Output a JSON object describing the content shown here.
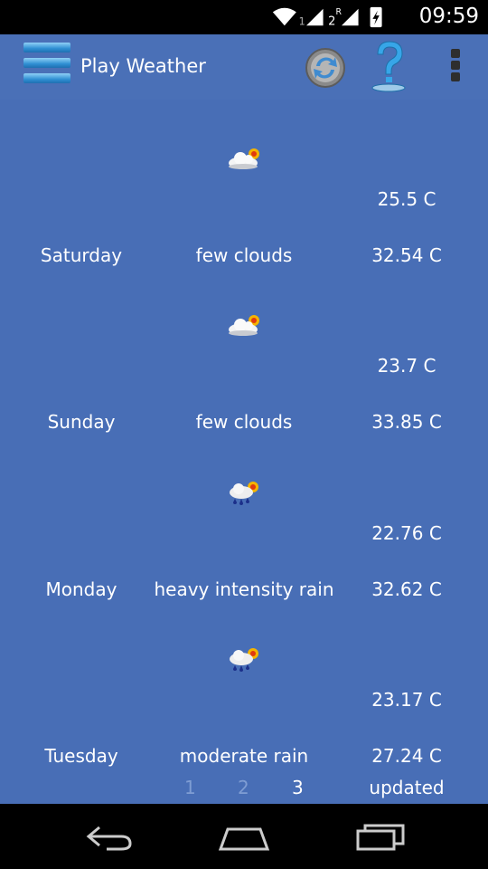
{
  "status_bar": {
    "time": "09:59",
    "sim1": "1",
    "sim2": "2",
    "roaming": "R"
  },
  "app": {
    "title": "Play Weather"
  },
  "forecast": [
    {
      "day": "Saturday",
      "description": "few clouds",
      "min": "25.5 C",
      "max": "32.54 C",
      "icon": "few-clouds-icon"
    },
    {
      "day": "Sunday",
      "description": "few clouds",
      "min": "23.7 C",
      "max": "33.85 C",
      "icon": "few-clouds-icon"
    },
    {
      "day": "Monday",
      "description": "heavy intensity rain",
      "min": "22.76 C",
      "max": "32.62 C",
      "icon": "rain-icon"
    },
    {
      "day": "Tuesday",
      "description": "moderate rain",
      "min": "23.17 C",
      "max": "27.24 C",
      "icon": "rain-icon"
    }
  ],
  "pager": {
    "pages": [
      "1",
      "2",
      "3"
    ],
    "current": "3",
    "status": "updated"
  },
  "colors": {
    "background": "#486eb6",
    "actionbar": "#4a70b7",
    "text": "#ffffff"
  }
}
